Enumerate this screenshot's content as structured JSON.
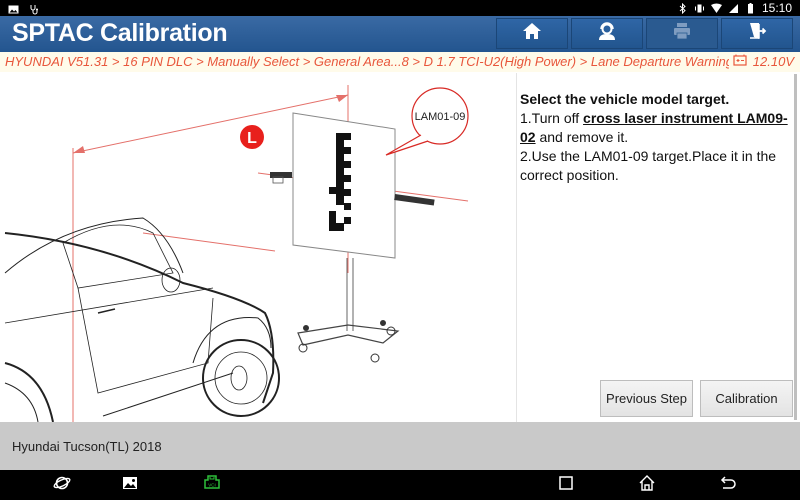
{
  "status_bar": {
    "left_icons": [
      "image-notification-icon",
      "stethoscope-icon"
    ],
    "right_icons": [
      "bluetooth-icon",
      "vibrate-icon",
      "wifi-icon",
      "signal-icon",
      "battery-icon"
    ],
    "time": "15:10"
  },
  "header": {
    "title": "SPTAC Calibration",
    "buttons": [
      {
        "name": "home",
        "icon": "home-icon",
        "enabled": true
      },
      {
        "name": "support",
        "icon": "headset-user-icon",
        "enabled": true
      },
      {
        "name": "print",
        "icon": "printer-icon",
        "enabled": false
      },
      {
        "name": "exit",
        "icon": "exit-door-icon",
        "enabled": true
      }
    ],
    "accent_color": "#2b5d96"
  },
  "breadcrumb": {
    "path": "HYUNDAI V51.31 > 16 PIN DLC > Manually Select > General Area...8 > D 1.7 TCI-U2(High Power) > Lane Departure Warning System",
    "voltage": "12.10V",
    "text_color": "#e8563b"
  },
  "illustration": {
    "distance_label": "L",
    "target_callout": "LAM01-09"
  },
  "instructions": {
    "title": "Select the vehicle model target.",
    "step1_prefix": "1.Turn off ",
    "step1_link": "cross laser instrument LAM09-02",
    "step1_suffix": " and remove it.",
    "step2": "2.Use the LAM01-09 target.Place it in the correct position."
  },
  "actions": {
    "previous_step": "Previous Step",
    "calibration": "Calibration"
  },
  "footer": {
    "vehicle": "Hyundai Tucson(TL) 2018"
  },
  "nav_bar": {
    "left_icons": [
      "browser-orbit-icon",
      "gallery-icon",
      "vci-icon"
    ],
    "right_icons": [
      "recent-apps-icon",
      "home-nav-icon",
      "back-icon"
    ],
    "vci_color": "#2ec13a"
  }
}
